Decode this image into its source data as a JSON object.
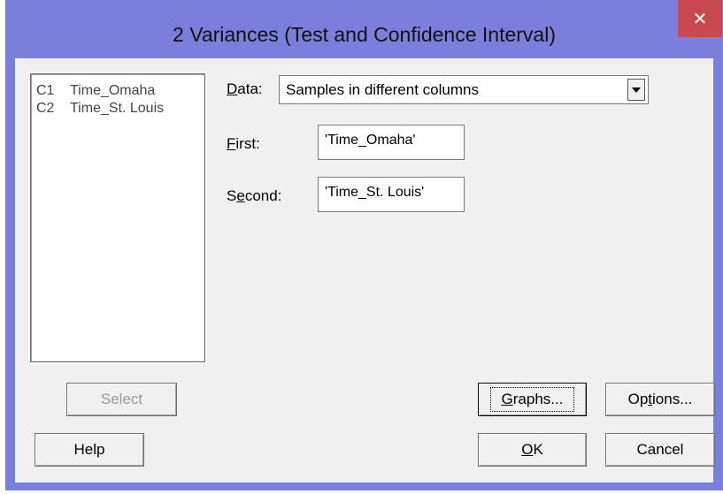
{
  "window": {
    "title": "2 Variances (Test and Confidence Interval)",
    "close_glyph": "✕"
  },
  "variable_list": [
    {
      "col": "C1",
      "name": "Time_Omaha"
    },
    {
      "col": "C2",
      "name": "Time_St. Louis"
    }
  ],
  "data_field": {
    "label_first": "D",
    "label_rest": "ata:",
    "selected": "Samples in different columns"
  },
  "first_field": {
    "label_first": "F",
    "label_rest": "irst:",
    "value": "'Time_Omaha'"
  },
  "second_field": {
    "label_pre": "S",
    "label_u": "e",
    "label_rest": "cond:",
    "value": "'Time_St. Louis'"
  },
  "buttons": {
    "select": "Select",
    "graphs_u": "G",
    "graphs_rest": "raphs...",
    "options_pre": "Op",
    "options_u": "t",
    "options_rest": "ions...",
    "help": "Help",
    "ok_u": "O",
    "ok_rest": "K",
    "cancel": "Cancel"
  }
}
